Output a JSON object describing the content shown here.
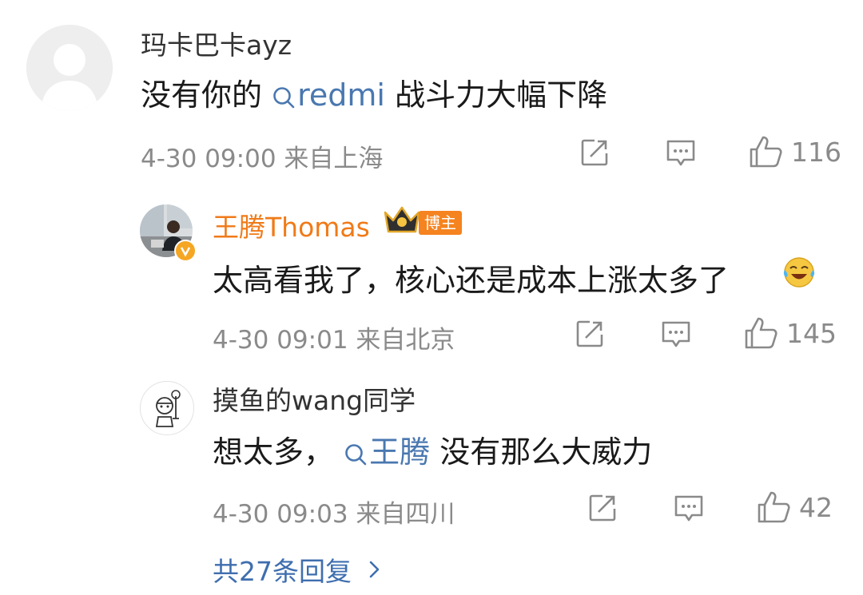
{
  "comment": {
    "username": "玛卡巴卡ayz",
    "text_before": "没有你的",
    "topic": "redmi",
    "text_after": "战斗力大幅下降",
    "time": "4-30 09:00",
    "location": "来自上海",
    "likes": "116"
  },
  "replies": [
    {
      "username": "王腾Thomas",
      "badge": "博主",
      "text": "太高看我了，核心还是成本上涨太多了",
      "emoji": "laugh-cry-emoji",
      "time": "4-30 09:01",
      "location": "来自北京",
      "likes": "145"
    },
    {
      "username": "摸鱼的wang同学",
      "text_before": "想太多，",
      "topic": "王腾",
      "text_after": "没有那么大威力",
      "time": "4-30 09:03",
      "location": "来自四川",
      "likes": "42"
    }
  ],
  "more_replies": "共27条回复",
  "icons": [
    "share-icon",
    "comment-icon",
    "like-icon",
    "search-icon",
    "chevron-right-icon",
    "crown-icon",
    "verified-icon"
  ],
  "colors": {
    "blogger_name": "#f07a18",
    "badge": "#f5831f",
    "link": "#4a78b0",
    "meta": "#8a8a8a"
  }
}
